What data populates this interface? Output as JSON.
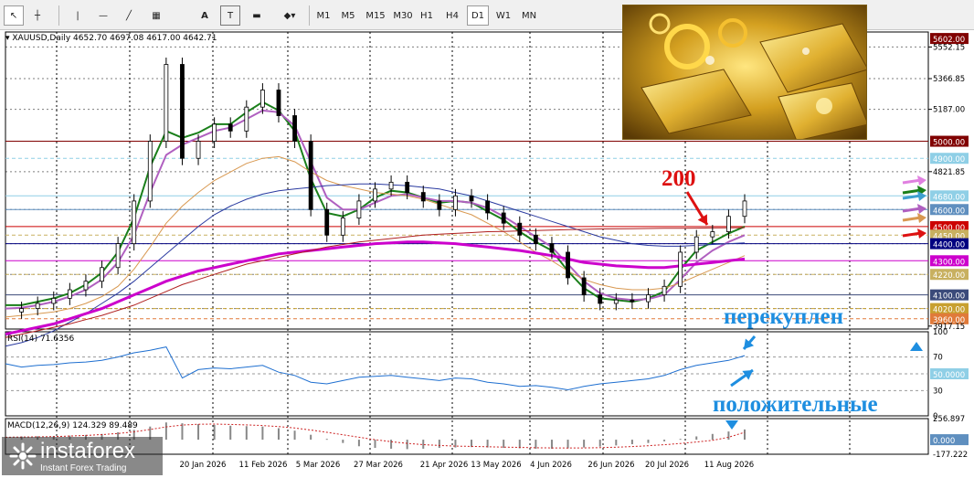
{
  "toolbar": {
    "tools": [
      {
        "name": "cursor-icon",
        "glyph": "↖"
      },
      {
        "name": "crosshair-icon",
        "glyph": "┼"
      },
      {
        "name": "vertical-line-icon",
        "glyph": "|"
      },
      {
        "name": "horizontal-line-icon",
        "glyph": "—"
      },
      {
        "name": "trendline-icon",
        "glyph": "╱"
      },
      {
        "name": "channel-icon",
        "glyph": "▦"
      },
      {
        "name": "text-icon",
        "glyph": "A"
      },
      {
        "name": "label-icon",
        "glyph": "T"
      },
      {
        "name": "shapes-icon",
        "glyph": "▬"
      },
      {
        "name": "arrow-tool-icon",
        "glyph": "◆▾"
      }
    ],
    "timeframes": [
      "M1",
      "M5",
      "M15",
      "M30",
      "H1",
      "H4",
      "D1",
      "W1",
      "MN"
    ],
    "active_timeframe": "D1"
  },
  "chart_data": {
    "type": "line",
    "instrument": "XAUUSD,Daily",
    "ohlc_header": "4652.70 4697.08 4617.00 4642.71",
    "price_axis": {
      "ylim": [
        3900,
        5640
      ],
      "ticks": [
        {
          "label": "5602.00",
          "value": 5602,
          "box": true,
          "color": "#800000"
        },
        {
          "label": "5552.15",
          "value": 5552.15
        },
        {
          "label": "5366.85",
          "value": 5366.85
        },
        {
          "label": "5187.00",
          "value": 5187
        },
        {
          "label": "5000.00",
          "value": 5000,
          "box": true,
          "color": "#800000"
        },
        {
          "label": "4900.00",
          "value": 4900,
          "box": true,
          "color": "#8fcfe6"
        },
        {
          "label": "4821.85",
          "value": 4821.85
        },
        {
          "label": "4680.00",
          "value": 4680,
          "box": true,
          "color": "#8fcfe6"
        },
        {
          "label": "4600.00",
          "value": 4600,
          "box": true,
          "color": "#5f8fbf"
        },
        {
          "label": "4500.00",
          "value": 4500,
          "box": true,
          "color": "#cc0000"
        },
        {
          "label": "4450.00",
          "value": 4450,
          "box": true,
          "color": "#c8b060"
        },
        {
          "label": "4400.00",
          "value": 4400,
          "box": true,
          "color": "#000080"
        },
        {
          "label": "4300.00",
          "value": 4300,
          "box": true,
          "color": "#cc00cc"
        },
        {
          "label": "4220.00",
          "value": 4220,
          "box": true,
          "color": "#c8b060"
        },
        {
          "label": "4100.00",
          "value": 4100,
          "box": true,
          "color": "#3b4a7a"
        },
        {
          "label": "4020.00",
          "value": 4020,
          "box": true,
          "color": "#c8a030"
        },
        {
          "label": "3960.00",
          "value": 3960,
          "box": true,
          "color": "#e07a3a"
        },
        {
          "label": "3917.15",
          "value": 3917.15
        }
      ]
    },
    "levels": [
      {
        "value": 5000,
        "color": "#800000",
        "style": "solid"
      },
      {
        "value": 4900,
        "color": "#8fcfe6",
        "style": "dashed"
      },
      {
        "value": 4680,
        "color": "#8fcfe6",
        "style": "solid"
      },
      {
        "value": 4600,
        "color": "#5f8fbf",
        "style": "solid"
      },
      {
        "value": 4500,
        "color": "#cc0000",
        "style": "solid"
      },
      {
        "value": 4450,
        "color": "#c8b060",
        "style": "dashed"
      },
      {
        "value": 4400,
        "color": "#000080",
        "style": "solid"
      },
      {
        "value": 4300,
        "color": "#cc00cc",
        "style": "solid"
      },
      {
        "value": 4220,
        "color": "#c8b060",
        "style": "dashed"
      },
      {
        "value": 4100,
        "color": "#3b4a7a",
        "style": "solid"
      },
      {
        "value": 4020,
        "color": "#c8a030",
        "style": "dashed"
      },
      {
        "value": 3960,
        "color": "#e07a3a",
        "style": "dashed"
      }
    ],
    "date_axis": [
      "20 Jan 2026",
      "11 Feb 2026",
      "5 Mar 2026",
      "27 Mar 2026",
      "21 Apr 2026",
      "13 May 2026",
      "4 Jun 2026",
      "26 Jun 2026",
      "20 Jul 2026",
      "11 Aug 2026"
    ],
    "price_close": [
      4000,
      4020,
      4050,
      4080,
      4130,
      4180,
      4260,
      4400,
      4650,
      5000,
      5450,
      4900,
      5000,
      5100,
      5060,
      5200,
      5300,
      5150,
      5000,
      4600,
      4450,
      4550,
      4650,
      4720,
      4760,
      4700,
      4650,
      4600,
      4680,
      4650,
      4580,
      4520,
      4450,
      4400,
      4350,
      4200,
      4100,
      4050,
      4070,
      4060,
      4100,
      4150,
      4350,
      4440,
      4470,
      4560,
      4650
    ],
    "ma_series": [
      {
        "color": "#1a7f1a",
        "width": 2,
        "values": [
          4040,
          4040,
          4060,
          4080,
          4110,
          4160,
          4230,
          4350,
          4550,
          4850,
          5060,
          5020,
          5050,
          5100,
          5100,
          5170,
          5230,
          5180,
          5060,
          4780,
          4580,
          4560,
          4600,
          4670,
          4710,
          4700,
          4670,
          4640,
          4650,
          4640,
          4590,
          4540,
          4470,
          4410,
          4360,
          4240,
          4140,
          4080,
          4070,
          4060,
          4080,
          4120,
          4250,
          4360,
          4410,
          4460,
          4500
        ]
      },
      {
        "color": "#b060c0",
        "width": 2,
        "values": [
          4020,
          4025,
          4040,
          4060,
          4090,
          4130,
          4190,
          4290,
          4450,
          4700,
          4920,
          4980,
          5020,
          5060,
          5080,
          5130,
          5180,
          5170,
          5090,
          4880,
          4670,
          4600,
          4600,
          4640,
          4680,
          4690,
          4670,
          4650,
          4650,
          4640,
          4610,
          4560,
          4500,
          4440,
          4380,
          4280,
          4180,
          4110,
          4080,
          4070,
          4075,
          4100,
          4190,
          4290,
          4360,
          4410,
          4450
        ]
      },
      {
        "color": "#d89850",
        "width": 1,
        "values": [
          3970,
          3980,
          3990,
          4000,
          4020,
          4050,
          4090,
          4150,
          4250,
          4380,
          4520,
          4620,
          4700,
          4770,
          4820,
          4870,
          4900,
          4910,
          4880,
          4820,
          4770,
          4740,
          4720,
          4700,
          4690,
          4680,
          4660,
          4630,
          4600,
          4570,
          4520,
          4470,
          4410,
          4350,
          4300,
          4240,
          4190,
          4160,
          4140,
          4130,
          4130,
          4140,
          4170,
          4210,
          4250,
          4290,
          4330
        ]
      },
      {
        "color": "#2a3aa0",
        "width": 1,
        "values": [
          3800,
          3820,
          3850,
          3890,
          3940,
          3990,
          4050,
          4110,
          4180,
          4260,
          4340,
          4420,
          4500,
          4570,
          4620,
          4660,
          4690,
          4710,
          4720,
          4730,
          4740,
          4745,
          4750,
          4750,
          4745,
          4740,
          4730,
          4720,
          4700,
          4680,
          4650,
          4620,
          4590,
          4560,
          4530,
          4500,
          4470,
          4440,
          4420,
          4400,
          4390,
          4385,
          4385,
          4390,
          4395,
          4400,
          4405
        ]
      },
      {
        "color": "#cc00cc",
        "width": 3,
        "values": [
          3870,
          3890,
          3910,
          3930,
          3960,
          3990,
          4020,
          4060,
          4100,
          4140,
          4180,
          4210,
          4240,
          4260,
          4280,
          4300,
          4320,
          4340,
          4350,
          4360,
          4370,
          4380,
          4390,
          4400,
          4405,
          4410,
          4410,
          4405,
          4400,
          4390,
          4380,
          4370,
          4360,
          4345,
          4330,
          4310,
          4290,
          4280,
          4270,
          4265,
          4260,
          4260,
          4270,
          4280,
          4290,
          4300,
          4310
        ]
      },
      {
        "color": "#b02020",
        "width": 1,
        "values": [
          3850,
          3870,
          3890,
          3910,
          3930,
          3955,
          3980,
          4010,
          4040,
          4080,
          4120,
          4160,
          4190,
          4220,
          4250,
          4280,
          4300,
          4320,
          4340,
          4360,
          4380,
          4395,
          4410,
          4420,
          4430,
          4440,
          4450,
          4455,
          4460,
          4465,
          4470,
          4472,
          4475,
          4477,
          4480,
          4482,
          4484,
          4486,
          4487,
          4488,
          4489,
          4490,
          4490,
          4491,
          4492,
          4493,
          4494
        ]
      }
    ],
    "rsi": {
      "label": "RSI(14) 71.6356",
      "ylim": [
        0,
        100
      ],
      "ticks": [
        {
          "label": "100",
          "value": 100
        },
        {
          "label": "70",
          "value": 70
        },
        {
          "label": "50.0000",
          "value": 50,
          "box": true,
          "color": "#8fcfe6"
        },
        {
          "label": "30",
          "value": 30
        },
        {
          "label": "0",
          "value": 0
        }
      ],
      "values": [
        62,
        58,
        60,
        61,
        63,
        64,
        66,
        70,
        75,
        78,
        82,
        45,
        55,
        57,
        56,
        58,
        60,
        52,
        48,
        40,
        38,
        42,
        46,
        47,
        48,
        46,
        44,
        42,
        45,
        44,
        40,
        38,
        35,
        36,
        34,
        31,
        35,
        38,
        40,
        42,
        44,
        48,
        55,
        60,
        63,
        66,
        71.6
      ]
    },
    "macd": {
      "label": "MACD(12,26,9) 124.329 89.489",
      "ylim": [
        -177.222,
        256.897
      ],
      "ticks": [
        {
          "label": "256.897",
          "value": 256.897
        },
        {
          "label": "0.000",
          "value": 0,
          "box": true,
          "color": "#5f8fbf"
        },
        {
          "label": "-177.222",
          "value": -177.222
        }
      ],
      "histogram": [
        40,
        40,
        42,
        45,
        50,
        58,
        70,
        90,
        120,
        160,
        210,
        200,
        190,
        180,
        170,
        165,
        160,
        140,
        110,
        60,
        10,
        -40,
        -80,
        -100,
        -110,
        -115,
        -110,
        -100,
        -95,
        -90,
        -95,
        -100,
        -105,
        -110,
        -110,
        -105,
        -95,
        -85,
        -70,
        -55,
        -40,
        -20,
        10,
        40,
        70,
        100,
        124.3
      ],
      "signal": [
        30,
        32,
        34,
        38,
        44,
        52,
        62,
        76,
        96,
        124,
        156,
        178,
        188,
        190,
        186,
        180,
        172,
        160,
        142,
        118,
        90,
        60,
        30,
        0,
        -25,
        -45,
        -60,
        -70,
        -78,
        -82,
        -86,
        -90,
        -94,
        -98,
        -100,
        -101,
        -100,
        -97,
        -92,
        -84,
        -74,
        -62,
        -46,
        -28,
        -8,
        30,
        89.5
      ]
    },
    "annotations": {
      "ma200_label": "200",
      "overbought": "перекуплен",
      "positive": "положительные"
    }
  },
  "watermark": {
    "name": "instaforex",
    "tagline": "Instant Forex Trading"
  }
}
